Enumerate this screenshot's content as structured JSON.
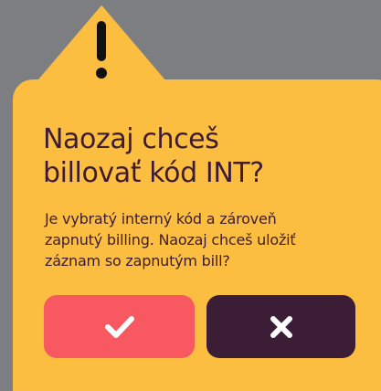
{
  "dialog": {
    "title_line1": "Naozaj chceš",
    "title_line2": "billovať kód INT?",
    "message_line1": "Je vybratý interný kód a zároveň",
    "message_line2": "zapnutý billing. Naozaj chceš uložiť",
    "message_line3": "záznam so zapnutým bill?"
  },
  "icons": {
    "warning": "warning-triangle-icon",
    "confirm": "check-icon",
    "cancel": "close-icon"
  },
  "colors": {
    "background": "#7d7e81",
    "card": "#fcbe40",
    "text": "#3d1c33",
    "confirm": "#f8585f",
    "cancel": "#3c1d36"
  }
}
